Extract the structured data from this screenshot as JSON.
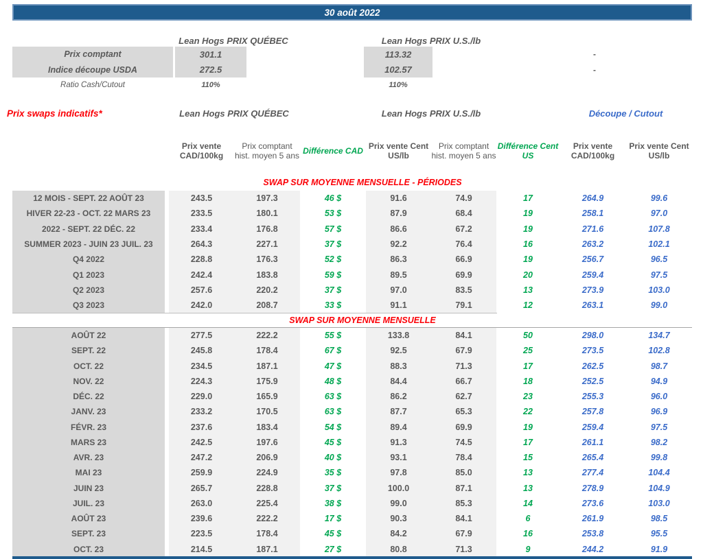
{
  "report": {
    "date": "30 août 2022",
    "top": {
      "qc_header": "Lean Hogs PRIX QUÉBEC",
      "us_header": "Lean Hogs PRIX U.S./lb",
      "rows": [
        {
          "label": "Prix comptant",
          "qc": "301.1",
          "us": "113.32",
          "right": "-"
        },
        {
          "label": "Indice découpe USDA",
          "qc": "272.5",
          "us": "102.57",
          "right": "-"
        },
        {
          "label": "Ratio Cash/Cutout",
          "qc": "110%",
          "us": "110%",
          "right": ""
        }
      ]
    },
    "swaps": {
      "title": "Prix swaps indicatifs*",
      "qc_header": "Lean Hogs PRIX QUÉBEC",
      "us_header": "Lean Hogs PRIX U.S./lb",
      "cutout_header": "Découpe / Cutout",
      "col_headers": [
        "Prix vente CAD/100kg",
        "Prix comptant hist. moyen 5 ans",
        "Différence CAD",
        "Prix vente Cent US/lb",
        "Prix comptant hist. moyen 5 ans",
        "Différence Cent US",
        "Prix vente CAD/100kg",
        "Prix vente Cent US/lb"
      ],
      "sections": [
        {
          "title": "SWAP SUR MOYENNE MENSUELLE - PÉRIODES",
          "rows": [
            {
              "label": "12 MOIS - SEPT. 22 AOÛT 23",
              "values": [
                "243.5",
                "197.3",
                "46 $",
                "91.6",
                "74.9",
                "17",
                "264.9",
                "99.6"
              ]
            },
            {
              "label": "HIVER 22-23 - OCT. 22 MARS 23",
              "values": [
                "233.5",
                "180.1",
                "53 $",
                "87.9",
                "68.4",
                "19",
                "258.1",
                "97.0"
              ]
            },
            {
              "label": "2022 - SEPT. 22 DÉC. 22",
              "values": [
                "233.4",
                "176.8",
                "57 $",
                "86.6",
                "67.2",
                "19",
                "271.6",
                "107.8"
              ]
            },
            {
              "label": "SUMMER 2023 - JUIN 23 JUIL. 23",
              "values": [
                "264.3",
                "227.1",
                "37 $",
                "92.2",
                "76.4",
                "16",
                "263.2",
                "102.1"
              ]
            },
            {
              "label": "Q4 2022",
              "values": [
                "228.8",
                "176.3",
                "52 $",
                "86.3",
                "66.9",
                "19",
                "256.7",
                "96.5"
              ]
            },
            {
              "label": "Q1 2023",
              "values": [
                "242.4",
                "183.8",
                "59 $",
                "89.5",
                "69.9",
                "20",
                "259.4",
                "97.5"
              ]
            },
            {
              "label": "Q2 2023",
              "values": [
                "257.6",
                "220.2",
                "37 $",
                "97.0",
                "83.5",
                "13",
                "273.9",
                "103.0"
              ]
            },
            {
              "label": "Q3 2023",
              "values": [
                "242.0",
                "208.7",
                "33 $",
                "91.1",
                "79.1",
                "12",
                "263.1",
                "99.0"
              ]
            }
          ]
        },
        {
          "title": "SWAP SUR MOYENNE MENSUELLE",
          "rows": [
            {
              "label": "AOÛT 22",
              "values": [
                "277.5",
                "222.2",
                "55 $",
                "133.8",
                "84.1",
                "50",
                "298.0",
                "134.7"
              ]
            },
            {
              "label": "SEPT. 22",
              "values": [
                "245.8",
                "178.4",
                "67 $",
                "92.5",
                "67.9",
                "25",
                "273.5",
                "102.8"
              ]
            },
            {
              "label": "OCT. 22",
              "values": [
                "234.5",
                "187.1",
                "47 $",
                "88.3",
                "71.3",
                "17",
                "262.5",
                "98.7"
              ]
            },
            {
              "label": "NOV. 22",
              "values": [
                "224.3",
                "175.9",
                "48 $",
                "84.4",
                "66.7",
                "18",
                "252.5",
                "94.9"
              ]
            },
            {
              "label": "DÉC. 22",
              "values": [
                "229.0",
                "165.9",
                "63 $",
                "86.2",
                "62.7",
                "23",
                "255.3",
                "96.0"
              ]
            },
            {
              "label": "JANV. 23",
              "values": [
                "233.2",
                "170.5",
                "63 $",
                "87.7",
                "65.3",
                "22",
                "257.8",
                "96.9"
              ]
            },
            {
              "label": "FÉVR. 23",
              "values": [
                "237.6",
                "183.4",
                "54 $",
                "89.4",
                "69.9",
                "19",
                "259.4",
                "97.5"
              ]
            },
            {
              "label": "MARS 23",
              "values": [
                "242.5",
                "197.6",
                "45 $",
                "91.3",
                "74.5",
                "17",
                "261.1",
                "98.2"
              ]
            },
            {
              "label": "AVR. 23",
              "values": [
                "247.2",
                "206.9",
                "40 $",
                "93.1",
                "78.4",
                "15",
                "265.4",
                "99.8"
              ]
            },
            {
              "label": "MAI 23",
              "values": [
                "259.9",
                "224.9",
                "35 $",
                "97.8",
                "85.0",
                "13",
                "277.4",
                "104.4"
              ]
            },
            {
              "label": "JUIN 23",
              "values": [
                "265.7",
                "228.8",
                "37 $",
                "100.0",
                "87.1",
                "13",
                "278.9",
                "104.9"
              ]
            },
            {
              "label": "JUIL. 23",
              "values": [
                "263.0",
                "225.4",
                "38 $",
                "99.0",
                "85.3",
                "14",
                "273.6",
                "103.0"
              ]
            },
            {
              "label": "AOÛT 23",
              "values": [
                "239.6",
                "222.2",
                "17 $",
                "90.3",
                "84.1",
                "6",
                "261.9",
                "98.5"
              ]
            },
            {
              "label": "SEPT. 23",
              "values": [
                "223.5",
                "178.4",
                "45 $",
                "84.2",
                "67.9",
                "16",
                "253.8",
                "95.5"
              ]
            },
            {
              "label": "OCT. 23",
              "values": [
                "214.5",
                "187.1",
                "27 $",
                "80.8",
                "71.3",
                "9",
                "244.2",
                "91.9"
              ]
            }
          ]
        }
      ]
    }
  },
  "colors": {
    "barBlue": "#1F5B8D",
    "barBorder": "#6E94BC",
    "red": "#FB0007",
    "green": "#00A651",
    "blueText": "#3A6BC9",
    "grayText": "#595959",
    "bgLabel": "#D9D9D9",
    "bgLight": "#F1F1F1"
  }
}
